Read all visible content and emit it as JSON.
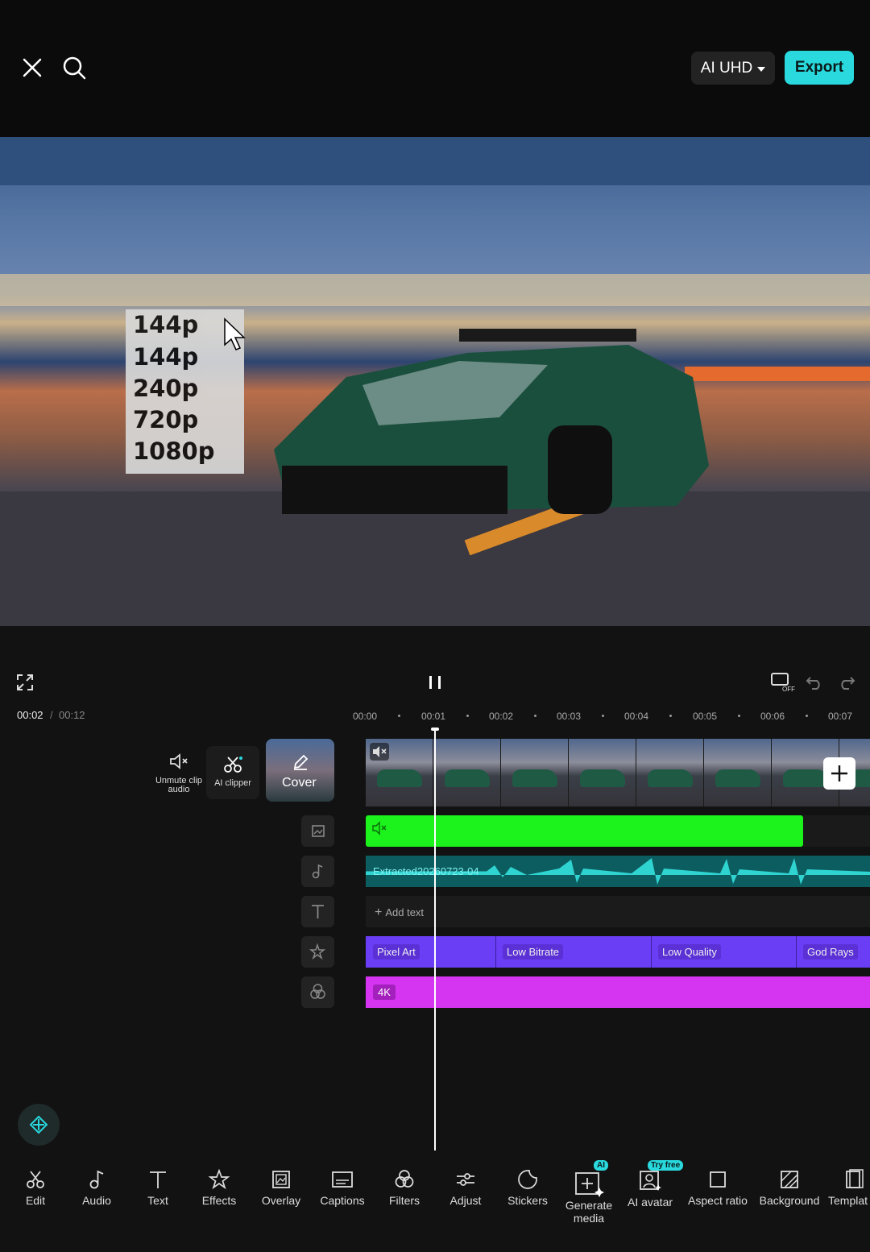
{
  "topbar": {
    "close_icon": "close-icon",
    "search_icon": "search-icon",
    "quality_label": "AI UHD",
    "export_label": "Export"
  },
  "preview": {
    "resolution_menu": [
      "144p",
      "144p",
      "240p",
      "720p",
      "1080p"
    ]
  },
  "playback": {
    "current_time": "00:02",
    "separator": "/",
    "total_time": "00:12"
  },
  "ruler": [
    "00:00",
    "00:01",
    "00:02",
    "00:03",
    "00:04",
    "00:05",
    "00:06",
    "00:07"
  ],
  "track_side": {
    "unmute_label": "Unmute clip audio",
    "ai_clipper_label": "AI clipper",
    "cover_label": "Cover"
  },
  "tracks": {
    "audio_label": "Extracted20260723-04",
    "add_text_label": "Add text",
    "effects": [
      "Pixel Art",
      "Low Bitrate",
      "Low Quality",
      "God Rays"
    ],
    "filter": "4K"
  },
  "toolbar": {
    "items": [
      "Edit",
      "Audio",
      "Text",
      "Effects",
      "Overlay",
      "Captions",
      "Filters",
      "Adjust",
      "Stickers",
      "Generate media",
      "AI avatar",
      "Aspect ratio",
      "Background",
      "Templat"
    ],
    "generate_badge": "AI",
    "avatar_badge": "Try free"
  },
  "colors": {
    "accent": "#29d9dd",
    "green_overlay": "#1cf21c",
    "effect_track": "#6a3ef5",
    "filter_track": "#d535f0"
  }
}
